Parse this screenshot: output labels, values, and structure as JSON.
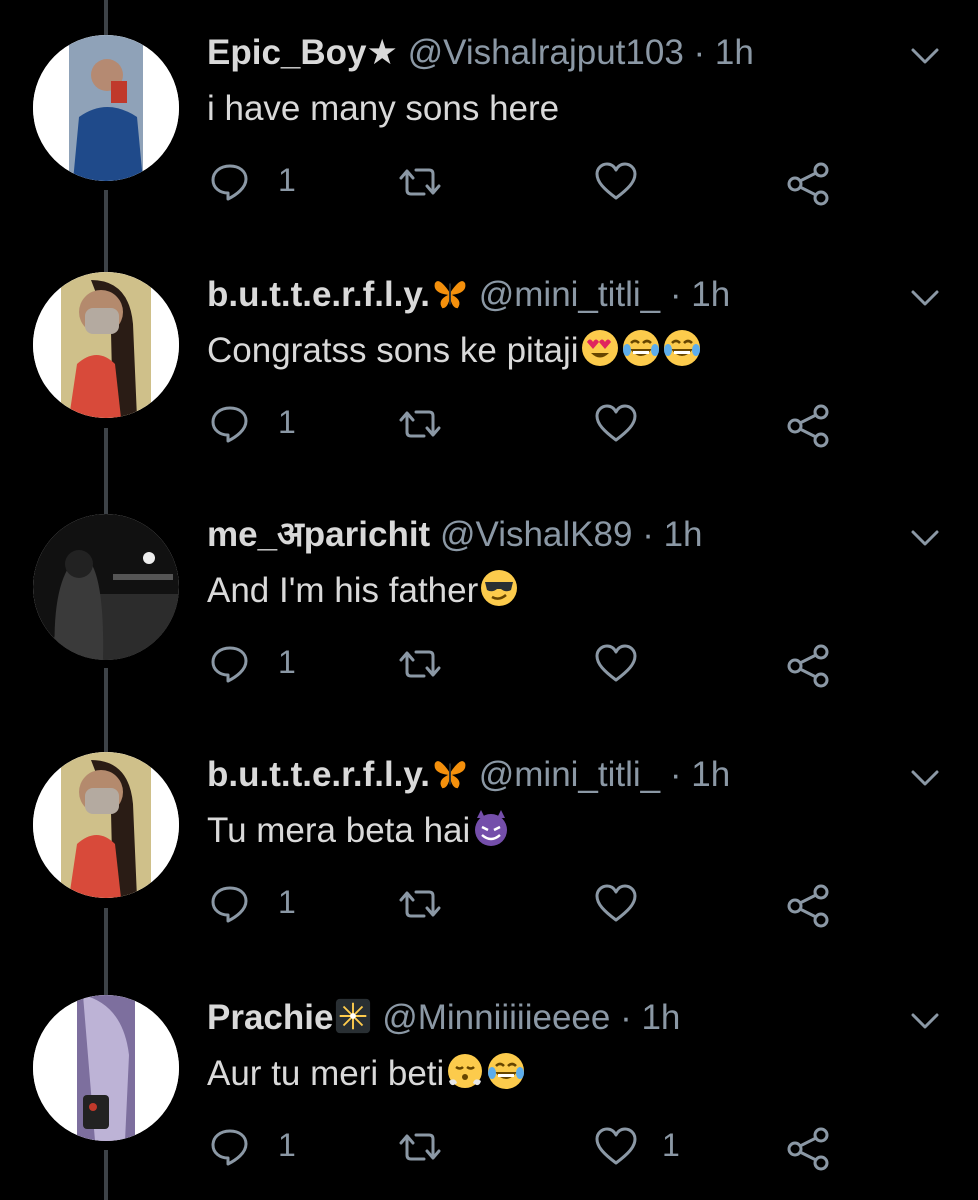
{
  "tweets": [
    {
      "name": "Epic_Boy★",
      "handle": "@Vishalrajput103",
      "separator": "·",
      "time": "1h",
      "text": "i have many sons here",
      "emojis": [],
      "reply_count": "1",
      "like_count": "",
      "avatar_icon": "man-selfie-avatar"
    },
    {
      "name": "b.u.t.t.e.r.f.l.y.",
      "name_icon": "butterfly-emoji",
      "handle": "@mini_titli_",
      "separator": "·",
      "time": "1h",
      "text": "Congratss sons ke pitaji",
      "emojis": [
        "heart-eyes",
        "tears-of-joy",
        "tears-of-joy"
      ],
      "reply_count": "1",
      "like_count": "",
      "avatar_icon": "masked-girl-avatar"
    },
    {
      "name": "me_अparichit",
      "handle": "@VishalK89",
      "separator": "·",
      "time": "1h",
      "text": "And I'm his father",
      "emojis": [
        "sunglasses"
      ],
      "reply_count": "1",
      "like_count": "",
      "avatar_icon": "hooded-figure-avatar"
    },
    {
      "name": "b.u.t.t.e.r.f.l.y.",
      "name_icon": "butterfly-emoji",
      "handle": "@mini_titli_",
      "separator": "·",
      "time": "1h",
      "text": "Tu mera beta hai",
      "emojis": [
        "smiling-devil"
      ],
      "reply_count": "1",
      "like_count": "",
      "avatar_icon": "masked-girl-avatar"
    },
    {
      "name": "Prachie",
      "name_icon": "fireworks-emoji",
      "handle": "@Minniiiiieeee",
      "separator": "·",
      "time": "1h",
      "text": "Aur tu meri beti",
      "emojis": [
        "face-with-steam",
        "tears-of-joy"
      ],
      "reply_count": "1",
      "like_count": "1",
      "avatar_icon": "girl-with-phone-avatar"
    }
  ],
  "colors": {
    "background": "#000000",
    "text": "#d9d9d9",
    "secondary": "#8b98a5",
    "thread_line": "#3d4247"
  }
}
